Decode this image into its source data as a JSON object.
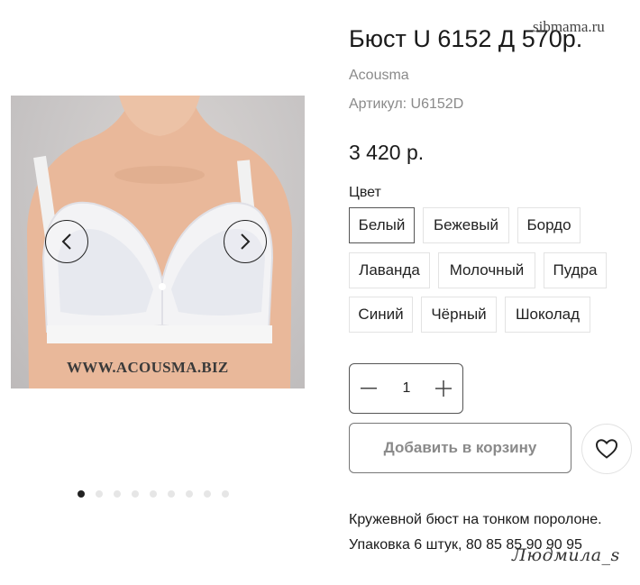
{
  "gallery": {
    "image_watermark": "WWW.ACOUSMA.BIZ",
    "prev_icon": "chevron-left-icon",
    "next_icon": "chevron-right-icon",
    "slide_count": 9,
    "active_slide": 1
  },
  "product": {
    "title": "Бюст U 6152 Д 570р.",
    "brand": "Acousma",
    "sku": "Артикул: U6152D",
    "price": "3 420 р.",
    "color_label": "Цвет",
    "colors": [
      "Белый",
      "Бежевый",
      "Бордо",
      "Лаванда",
      "Молочный",
      "Пудра",
      "Синий",
      "Чёрный",
      "Шоколад"
    ],
    "selected_color": "Белый"
  },
  "purchase": {
    "quantity": "1",
    "add_to_cart_label": "Добавить в корзину",
    "favorite_icon": "heart-icon"
  },
  "description": {
    "line1": "Кружевной бюст на тонком поролоне.",
    "line2": "Упаковка 6 штук, 80 85 85 90 90 95"
  },
  "watermarks": {
    "site": "sibmama.ru",
    "signature": "Людмила_s"
  },
  "colors": {
    "text": "#1a1a1a",
    "muted": "#8a8a8a",
    "border": "#e3e3e3",
    "active_dot": "#222222"
  }
}
